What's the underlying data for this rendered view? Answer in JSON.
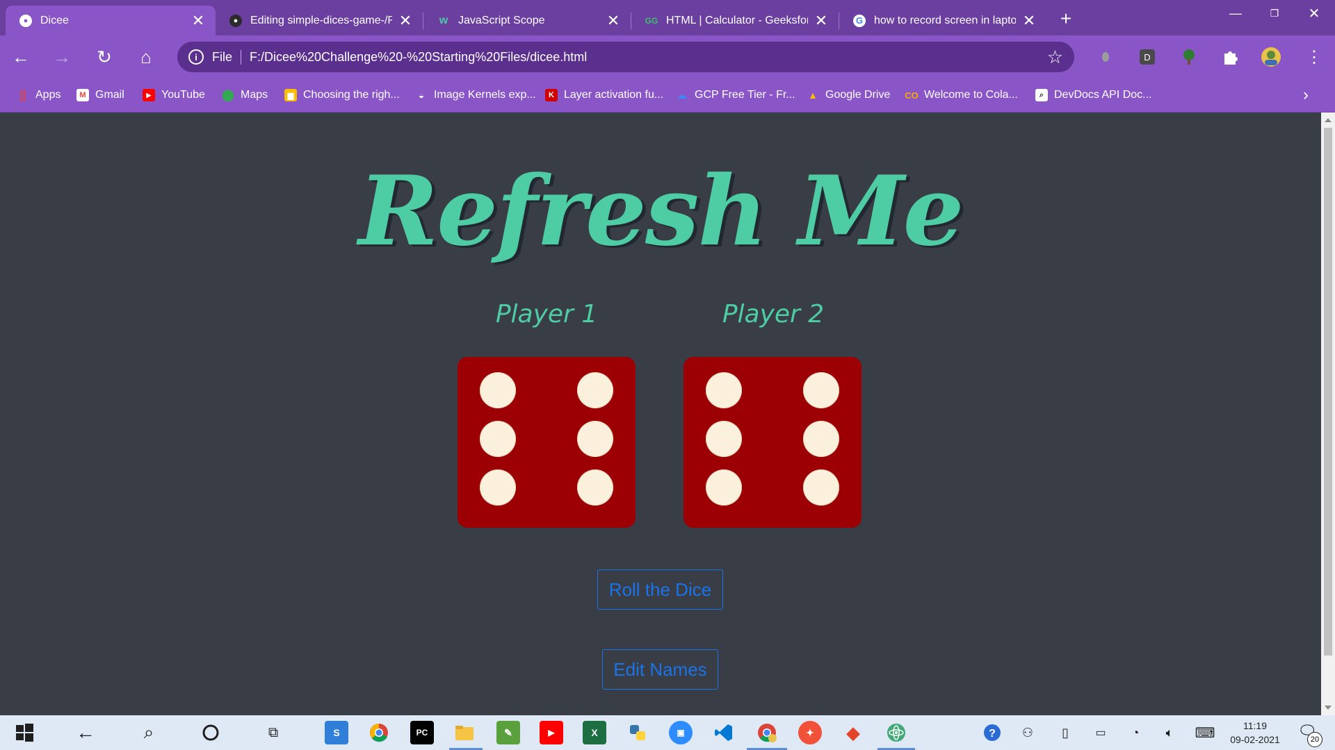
{
  "browser": {
    "tabs": [
      {
        "title": "Dicee",
        "active": true
      },
      {
        "title": "Editing simple-dices-game-/RE",
        "active": false
      },
      {
        "title": "JavaScript Scope",
        "active": false
      },
      {
        "title": "HTML | Calculator - GeeksforG",
        "active": false
      },
      {
        "title": "how to record screen in laptop",
        "active": false
      }
    ],
    "address": {
      "scheme": "File",
      "url": "F:/Dicee%20Challenge%20-%20Starting%20Files/dicee.html"
    },
    "profile_initial": "D",
    "bookmarks": [
      {
        "label": "Apps",
        "icon": "apps-grid-icon"
      },
      {
        "label": "Gmail",
        "icon": "gmail-icon"
      },
      {
        "label": "YouTube",
        "icon": "youtube-icon"
      },
      {
        "label": "Maps",
        "icon": "maps-icon"
      },
      {
        "label": "Choosing the righ...",
        "icon": "chart-icon"
      },
      {
        "label": "Image Kernels exp...",
        "icon": "github-icon"
      },
      {
        "label": "Layer activation fu...",
        "icon": "keras-icon"
      },
      {
        "label": "GCP Free Tier - Fr...",
        "icon": "gcp-icon"
      },
      {
        "label": "Google Drive",
        "icon": "drive-icon"
      },
      {
        "label": "Welcome to Cola...",
        "icon": "colab-icon"
      },
      {
        "label": "DevDocs API Doc...",
        "icon": "devdocs-icon"
      }
    ]
  },
  "page": {
    "heading": "Refresh Me",
    "players": [
      {
        "label": "Player 1",
        "die_value": 6
      },
      {
        "label": "Player 2",
        "die_value": 6
      }
    ],
    "roll_button": "Roll the Dice",
    "edit_button": "Edit Names",
    "colors": {
      "background": "#393e46",
      "accent": "#4ecca3",
      "die": "#9c0005",
      "pip": "#faf0dc",
      "button": "#1a73e8"
    }
  },
  "taskbar": {
    "time": "11:19",
    "date": "09-02-2021",
    "notification_count": "20",
    "apps": [
      "windows-start-icon",
      "back-arrow-icon",
      "search-icon",
      "cortana-icon",
      "task-view-icon",
      "app-s-icon",
      "chrome-icon",
      "pycharm-icon",
      "file-explorer-icon",
      "image-app-icon",
      "youtube-app-icon",
      "excel-icon",
      "python-icon",
      "zoom-icon",
      "vscode-icon",
      "chrome-profile-icon",
      "swift-icon",
      "git-icon",
      "atom-icon"
    ]
  }
}
